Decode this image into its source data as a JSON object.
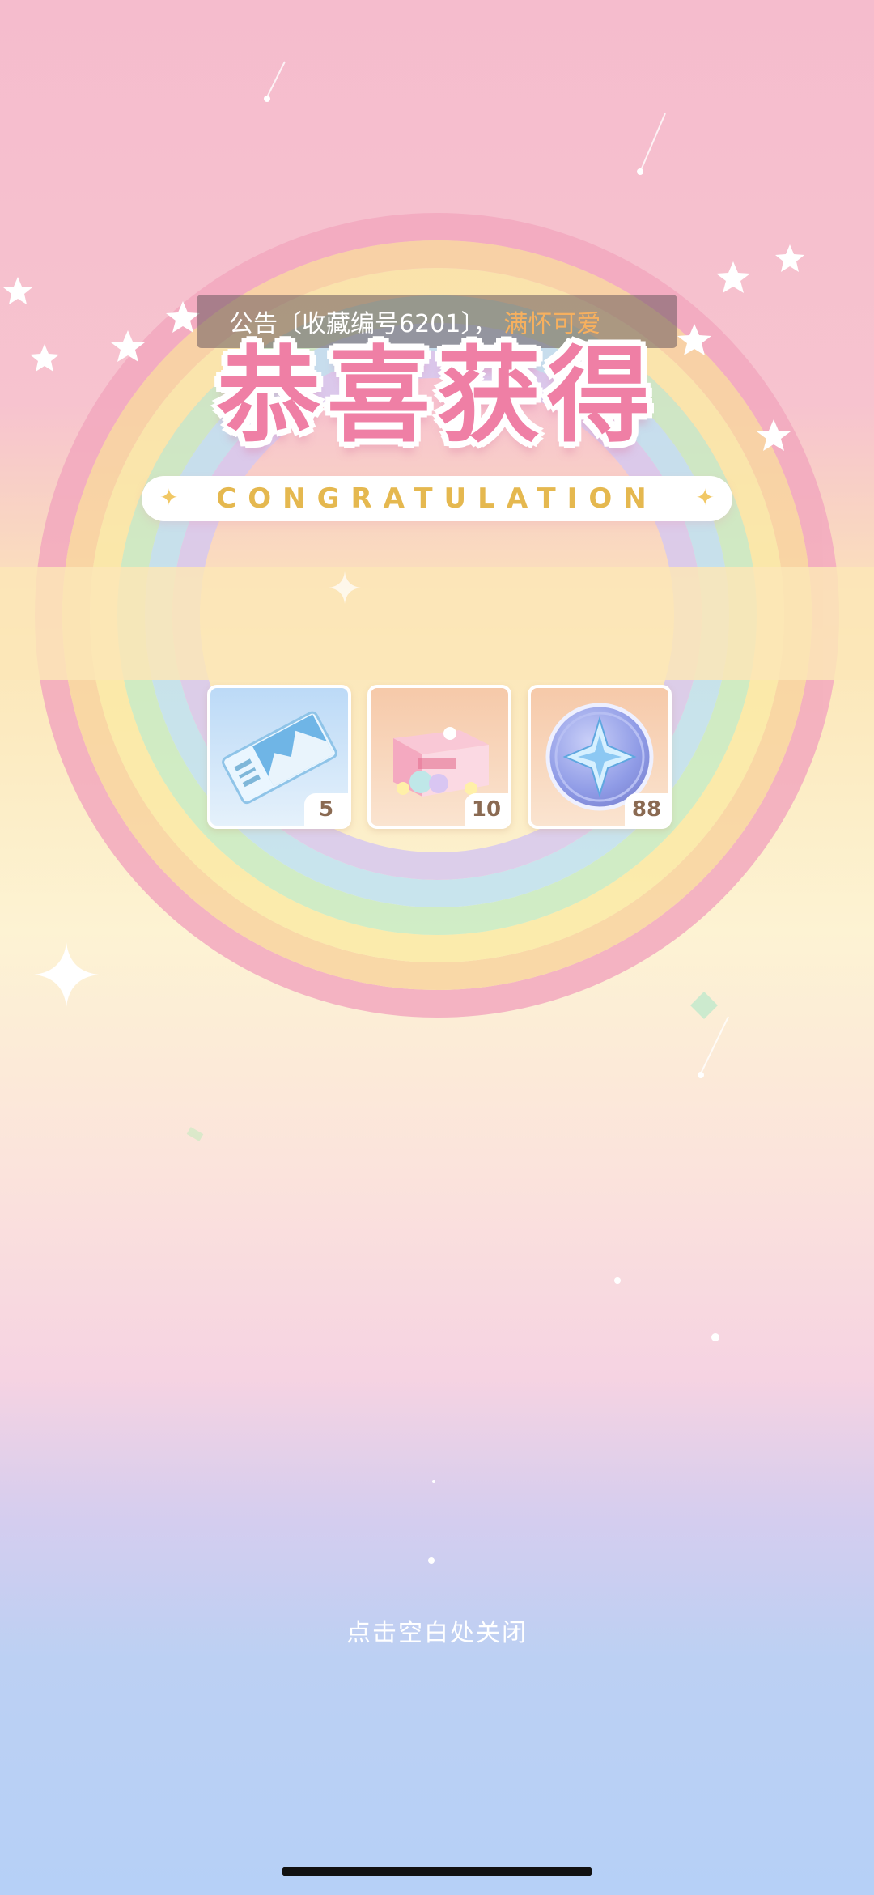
{
  "announcement": {
    "prefix": "公告〔收藏编号6201〕，",
    "highlight": "满怀可爱"
  },
  "title": "恭喜获得",
  "subtitle": "CONGRATULATION",
  "rewards": [
    {
      "icon": "ticket-icon",
      "count": "5"
    },
    {
      "icon": "gift-box-icon",
      "count": "10"
    },
    {
      "icon": "star-coin-icon",
      "count": "88"
    }
  ],
  "close_hint": "点击空白处关闭",
  "colors": {
    "title": "#ef7fa5",
    "subtitle": "#e5b84f",
    "announce_highlight": "#f6b05f"
  }
}
